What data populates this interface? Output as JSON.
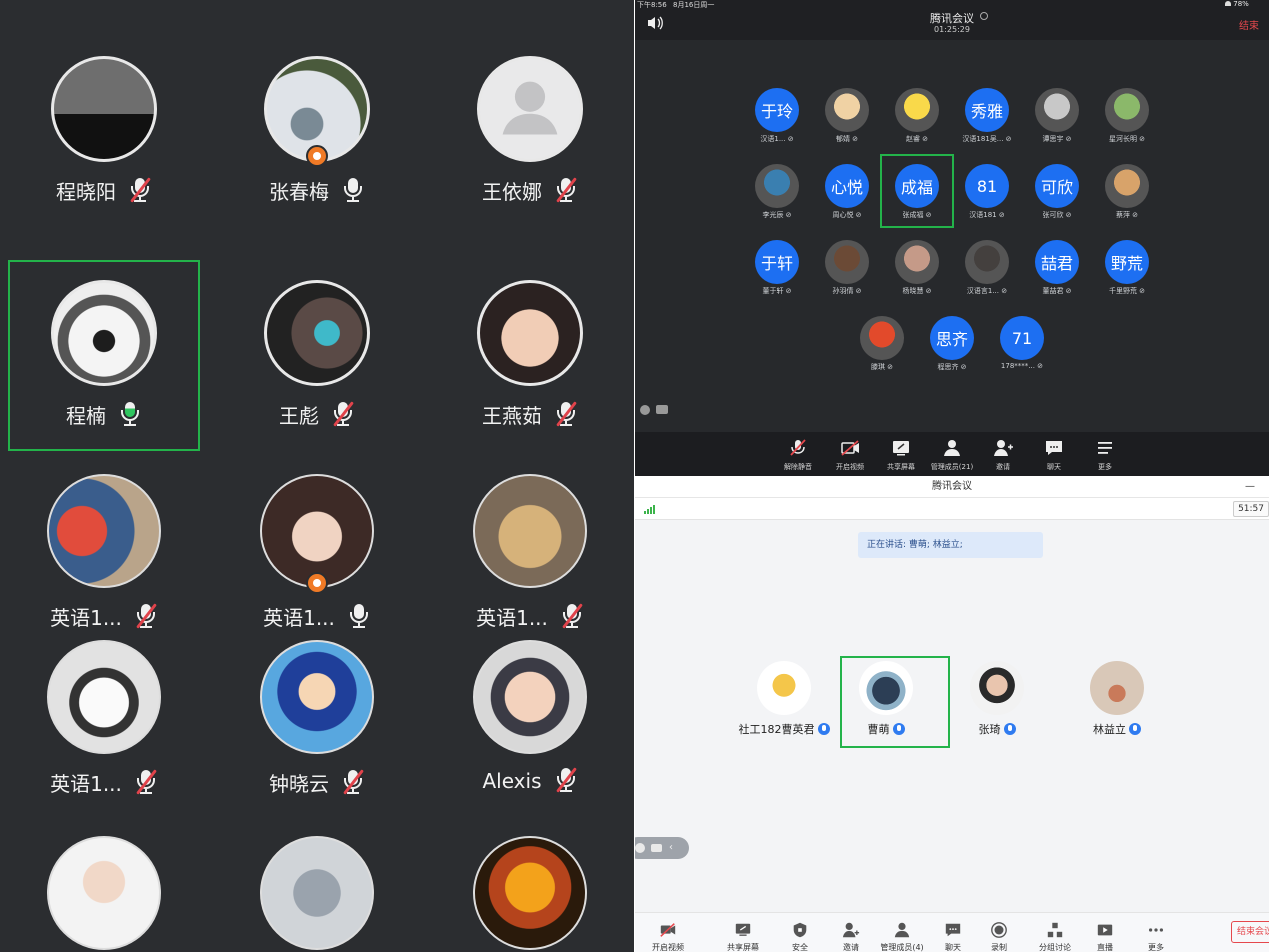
{
  "panel_a": {
    "participants": [
      {
        "name": "程晓阳",
        "mic": "muted"
      },
      {
        "name": "张春梅",
        "mic": "on"
      },
      {
        "name": "王依娜",
        "mic": "muted"
      },
      {
        "name": "程楠",
        "mic": "speaking"
      },
      {
        "name": "王彪",
        "mic": "muted"
      },
      {
        "name": "王燕茹",
        "mic": "muted"
      },
      {
        "name": "英语1...",
        "mic": "muted"
      },
      {
        "name": "英语1...",
        "mic": "on"
      },
      {
        "name": "英语1...",
        "mic": "muted"
      },
      {
        "name": "英语1...",
        "mic": "muted"
      },
      {
        "name": "钟晓云",
        "mic": "muted"
      },
      {
        "name": "Alexis",
        "mic": "muted"
      },
      {
        "name": "",
        "mic": ""
      },
      {
        "name": "",
        "mic": ""
      },
      {
        "name": "",
        "mic": ""
      }
    ]
  },
  "panel_b": {
    "status_time": "下午8:56",
    "status_date": "8月16日周一",
    "battery": "78%",
    "app_title": "腾讯会议",
    "elapsed": "01:25:29",
    "end_label": "结束",
    "participants": [
      {
        "avatar_text": "于玲",
        "label": "汉语1..."
      },
      {
        "avatar_text": "",
        "label": "郁婧"
      },
      {
        "avatar_text": "",
        "label": "赵睿"
      },
      {
        "avatar_text": "秀雅",
        "label": "汉语181吴..."
      },
      {
        "avatar_text": "",
        "label": "谭思宇"
      },
      {
        "avatar_text": "",
        "label": "星河长明"
      },
      {
        "avatar_text": "",
        "label": "李光辰"
      },
      {
        "avatar_text": "心悦",
        "label": "周心悦"
      },
      {
        "avatar_text": "成福",
        "label": "张成福"
      },
      {
        "avatar_text": "81",
        "label": "汉语181"
      },
      {
        "avatar_text": "可欣",
        "label": "张可欣"
      },
      {
        "avatar_text": "",
        "label": "蔡萍"
      },
      {
        "avatar_text": "于轩",
        "label": "董于轩"
      },
      {
        "avatar_text": "",
        "label": "孙羽倩"
      },
      {
        "avatar_text": "",
        "label": "杨晓慧"
      },
      {
        "avatar_text": "",
        "label": "汉语言1..."
      },
      {
        "avatar_text": "喆君",
        "label": "董喆君"
      },
      {
        "avatar_text": "野荒",
        "label": "千里野荒"
      },
      {
        "avatar_text": "",
        "label": "滕琪"
      },
      {
        "avatar_text": "思齐",
        "label": "程思齐"
      },
      {
        "avatar_text": "71",
        "label": "178****..."
      }
    ],
    "toolbar": [
      {
        "label": "解除静音",
        "icon": "mic-muted-icon"
      },
      {
        "label": "开启视频",
        "icon": "video-off-icon"
      },
      {
        "label": "共享屏幕",
        "icon": "share-screen-icon"
      },
      {
        "label": "管理成员(21)",
        "icon": "members-icon"
      },
      {
        "label": "邀请",
        "icon": "invite-icon"
      },
      {
        "label": "聊天",
        "icon": "chat-icon"
      },
      {
        "label": "更多",
        "icon": "more-icon"
      }
    ]
  },
  "panel_c": {
    "app_title": "腾讯会议",
    "minimize": "—",
    "timer": "51:57",
    "speaking": "正在讲话: 曹萌; 林益立;",
    "participants": [
      {
        "name": "社工182曹英君"
      },
      {
        "name": "曹萌"
      },
      {
        "name": "张琦"
      },
      {
        "name": "林益立"
      }
    ],
    "toolbar": [
      {
        "label": "开启视频",
        "icon": "video-off-icon"
      },
      {
        "label": "共享屏幕",
        "icon": "share-screen-icon"
      },
      {
        "label": "安全",
        "icon": "shield-icon"
      },
      {
        "label": "邀请",
        "icon": "invite-icon"
      },
      {
        "label": "管理成员(4)",
        "icon": "members-icon"
      },
      {
        "label": "聊天",
        "icon": "chat-icon"
      },
      {
        "label": "录制",
        "icon": "record-icon"
      },
      {
        "label": "分组讨论",
        "icon": "breakout-icon"
      },
      {
        "label": "直播",
        "icon": "live-icon"
      },
      {
        "label": "更多",
        "icon": "more-icon"
      }
    ],
    "end_label": "结束会议"
  }
}
